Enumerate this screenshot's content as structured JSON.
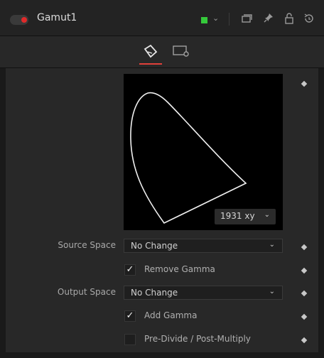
{
  "header": {
    "title": "Gamut1",
    "color_swatch": "#35c93b",
    "icons": [
      "power-toggle-icon",
      "chevron-down-icon",
      "window-icon",
      "pin-icon",
      "lock-icon",
      "reset-icon"
    ]
  },
  "tabs": [
    {
      "name": "controls-tab",
      "icon": "controls-pen-icon",
      "active": true
    },
    {
      "name": "settings-tab",
      "icon": "settings-screen-icon",
      "active": false
    }
  ],
  "scope": {
    "mode": "1931 xy"
  },
  "controls": {
    "source_space_label": "Source Space",
    "source_space_value": "No Change",
    "remove_gamma_label": "Remove Gamma",
    "remove_gamma_checked": true,
    "output_space_label": "Output Space",
    "output_space_value": "No Change",
    "add_gamma_label": "Add Gamma",
    "add_gamma_checked": true,
    "predivide_label": "Pre-Divide / Post-Multiply",
    "predivide_checked": false
  },
  "colors": {
    "accent": "#e0403a",
    "background": "#1a1a1a"
  }
}
